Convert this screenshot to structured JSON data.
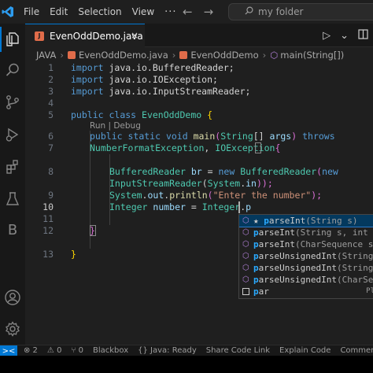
{
  "titlebar": {
    "menu": [
      "File",
      "Edit",
      "Selection",
      "View"
    ],
    "more": "···",
    "search_placeholder": "my folder"
  },
  "activity_bar": {
    "items": [
      "explorer-icon",
      "search-icon",
      "source-control-icon",
      "run-debug-icon",
      "extensions-icon",
      "testing-icon",
      "blackbox-icon"
    ],
    "b_label": "B"
  },
  "tab": {
    "label": "EvenOddDemo.java",
    "close": "×",
    "file_icon": "J"
  },
  "breadcrumb": {
    "root": "JAVA",
    "file": "EvenOddDemo.java",
    "class": "EvenOddDemo",
    "method": "main(String[])",
    "sep": "›"
  },
  "editor": {
    "line_numbers": [
      "1",
      "2",
      "3",
      "4",
      "5",
      "",
      "6",
      "7",
      "8",
      "9",
      "10",
      "11",
      "12",
      "13"
    ],
    "codelens": "Run | Debug",
    "lines": {
      "l1": {
        "kw": "import",
        "rest": " java.io.BufferedReader;"
      },
      "l2": {
        "kw": "import",
        "rest": " java.io.IOException;"
      },
      "l3": {
        "kw": "import",
        "rest": " java.io.InputStreamReader;"
      },
      "l5": {
        "kw1": "public",
        "kw2": " class",
        "ty": " EvenOddDemo",
        "br": " {"
      },
      "l6": {
        "kw1": "public",
        "kw2": " static",
        "kw3": " void",
        "fn": " main",
        "p1": "(",
        "ty": "String",
        "p2": "[]",
        "vr": " args",
        "p3": ")",
        "kw4": " throws"
      },
      "l7": {
        "ty1": "NumberFormatException",
        "p1": ", ",
        "ty2": "IOException",
        "br": "{"
      },
      "l8": {
        "ty": "BufferedReader",
        "vr": " br",
        "p1": " = ",
        "kw": "new",
        "ty2": " BufferedReader",
        "p2": "(",
        "kw2": "new"
      },
      "l8b": {
        "ty": "InputStreamReader",
        "p1": "(",
        "ty2": "System",
        "p2": ".",
        "vr": "in",
        "p3": "));"
      },
      "l9": {
        "ty": "System",
        "p1": ".",
        "vr": "out",
        "p2": ".",
        "fn": "println",
        "p3": "(",
        "st": "\"Enter the number\"",
        "p4": ");"
      },
      "l10": {
        "ty": "Integer",
        "vr": " number",
        "p1": " = ",
        "ty2": "Integer",
        "p2": ".",
        "vr2": "p"
      },
      "l12": {
        "br": "}"
      },
      "l13": {
        "br": "}"
      }
    }
  },
  "suggest": {
    "items": [
      {
        "star": "★ ",
        "hl": "p",
        "name": "arseInt",
        "detail": "(String s)",
        "right": ""
      },
      {
        "star": "",
        "hl": "p",
        "name": "arseInt",
        "detail": "(String s, int r",
        "right": ""
      },
      {
        "star": "",
        "hl": "p",
        "name": "arseInt",
        "detail": "(CharSequence s,",
        "right": ""
      },
      {
        "star": "",
        "hl": "p",
        "name": "arseUnsignedInt",
        "detail": "(String",
        "right": ""
      },
      {
        "star": "",
        "hl": "p",
        "name": "arseUnsignedInt",
        "detail": "(String",
        "right": ""
      },
      {
        "star": "",
        "hl": "p",
        "name": "arseUnsignedInt",
        "detail": "(CharSeq",
        "right": ""
      },
      {
        "star": "",
        "hl": "p",
        "name": "ar",
        "detail": "",
        "right": "Pl"
      }
    ]
  },
  "statusbar": {
    "remote": "><",
    "errors": "⊗ 2",
    "warnings": "⚠ 0",
    "ports": "⑂ 0",
    "blackbox": "Blackbox",
    "java": "{} Java: Ready",
    "share": "Share Code Link",
    "explain": "Explain Code",
    "comment": "Comment Code"
  }
}
